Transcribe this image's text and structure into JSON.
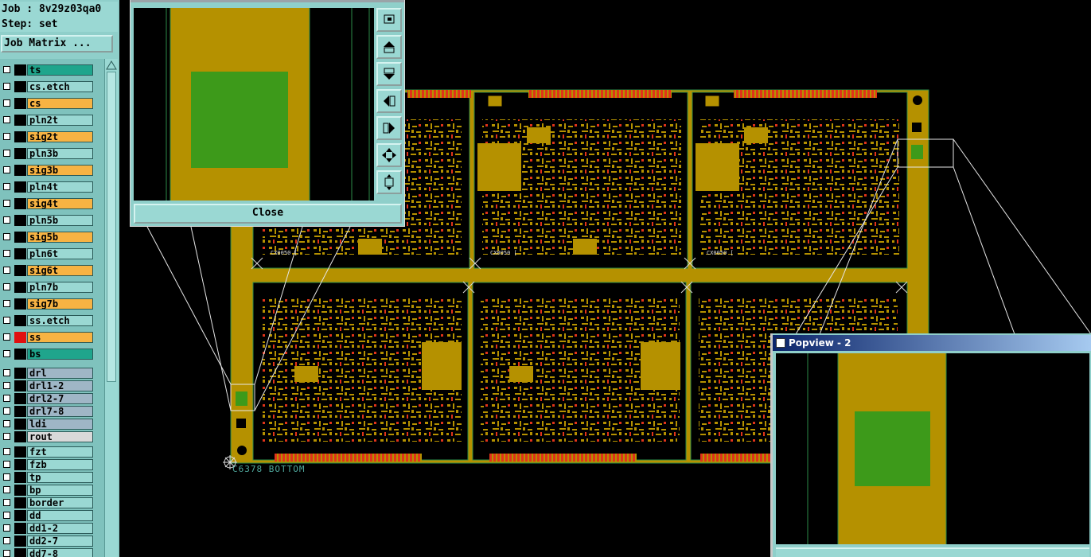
{
  "sidebar": {
    "job": "Job : 8v29z03qa0",
    "step": "Step: set",
    "job_matrix_label": "Job Matrix ...",
    "layers": [
      {
        "name": "ts",
        "fill": "#1fa58c",
        "swatch": "#000000"
      },
      {
        "name": "cs.etch",
        "fill": "#9ad8d3",
        "swatch": "#000000"
      },
      {
        "name": "cs",
        "fill": "#f7b343",
        "swatch": "#000000"
      },
      {
        "name": "pln2t",
        "fill": "#9ad8d3",
        "swatch": "#000000"
      },
      {
        "name": "sig2t",
        "fill": "#f7b343",
        "swatch": "#000000"
      },
      {
        "name": "pln3b",
        "fill": "#9ad8d3",
        "swatch": "#000000"
      },
      {
        "name": "sig3b",
        "fill": "#f7b343",
        "swatch": "#000000"
      },
      {
        "name": "pln4t",
        "fill": "#9ad8d3",
        "swatch": "#000000"
      },
      {
        "name": "sig4t",
        "fill": "#f7b343",
        "swatch": "#000000"
      },
      {
        "name": "pln5b",
        "fill": "#9ad8d3",
        "swatch": "#000000"
      },
      {
        "name": "sig5b",
        "fill": "#f7b343",
        "swatch": "#000000"
      },
      {
        "name": "pln6t",
        "fill": "#9ad8d3",
        "swatch": "#000000"
      },
      {
        "name": "sig6t",
        "fill": "#f7b343",
        "swatch": "#000000"
      },
      {
        "name": "pln7b",
        "fill": "#9ad8d3",
        "swatch": "#000000"
      },
      {
        "name": "sig7b",
        "fill": "#f7b343",
        "swatch": "#000000"
      },
      {
        "name": "ss.etch",
        "fill": "#9ad8d3",
        "swatch": "#000000"
      },
      {
        "name": "ss",
        "fill": "#f7b343",
        "swatch": "#e01010"
      },
      {
        "name": "bs",
        "fill": "#1fa58c",
        "swatch": "#000000"
      },
      {
        "name": "drl",
        "fill": "#9fb6c6",
        "swatch": "#000000"
      },
      {
        "name": "drl1-2",
        "fill": "#9fb6c6",
        "swatch": "#000000"
      },
      {
        "name": "drl2-7",
        "fill": "#9fb6c6",
        "swatch": "#000000"
      },
      {
        "name": "drl7-8",
        "fill": "#9fb6c6",
        "swatch": "#000000"
      },
      {
        "name": "ldi",
        "fill": "#9fb6c6",
        "swatch": "#000000"
      },
      {
        "name": "rout",
        "fill": "#d9d9d9",
        "swatch": "#000000"
      },
      {
        "name": "fzt",
        "fill": "#9ad8d3",
        "swatch": "#000000"
      },
      {
        "name": "fzb",
        "fill": "#9ad8d3",
        "swatch": "#000000"
      },
      {
        "name": "tp",
        "fill": "#9ad8d3",
        "swatch": "#000000"
      },
      {
        "name": "bp",
        "fill": "#9ad8d3",
        "swatch": "#000000"
      },
      {
        "name": "border",
        "fill": "#9ad8d3",
        "swatch": "#000000"
      },
      {
        "name": "dd",
        "fill": "#9ad8d3",
        "swatch": "#000000"
      },
      {
        "name": "dd1-2",
        "fill": "#9ad8d3",
        "swatch": "#000000"
      },
      {
        "name": "dd2-7",
        "fill": "#9ad8d3",
        "swatch": "#000000"
      },
      {
        "name": "dd7-8",
        "fill": "#9ad8d3",
        "swatch": "#000000"
      }
    ]
  },
  "popview1": {
    "close_label": "Close",
    "tools": [
      "zoom-window-icon",
      "pan-up-icon",
      "pan-down-icon",
      "pan-left-icon",
      "pan-right-icon",
      "zoom-fit-icon",
      "zoom-home-icon"
    ]
  },
  "popview2": {
    "title": "Popview - 2"
  },
  "canvas": {
    "status_text": "C6378  BOTTOM",
    "board_label_1": "CX0050 [",
    "board_label_2": "CX0050 [",
    "board_label_3": "CX0050 ["
  },
  "colors": {
    "copper": "#b59100",
    "pad_red": "#e0331a",
    "solder_green": "#3d9a1a",
    "board_outline": "#2c8a48",
    "background": "#000000"
  }
}
